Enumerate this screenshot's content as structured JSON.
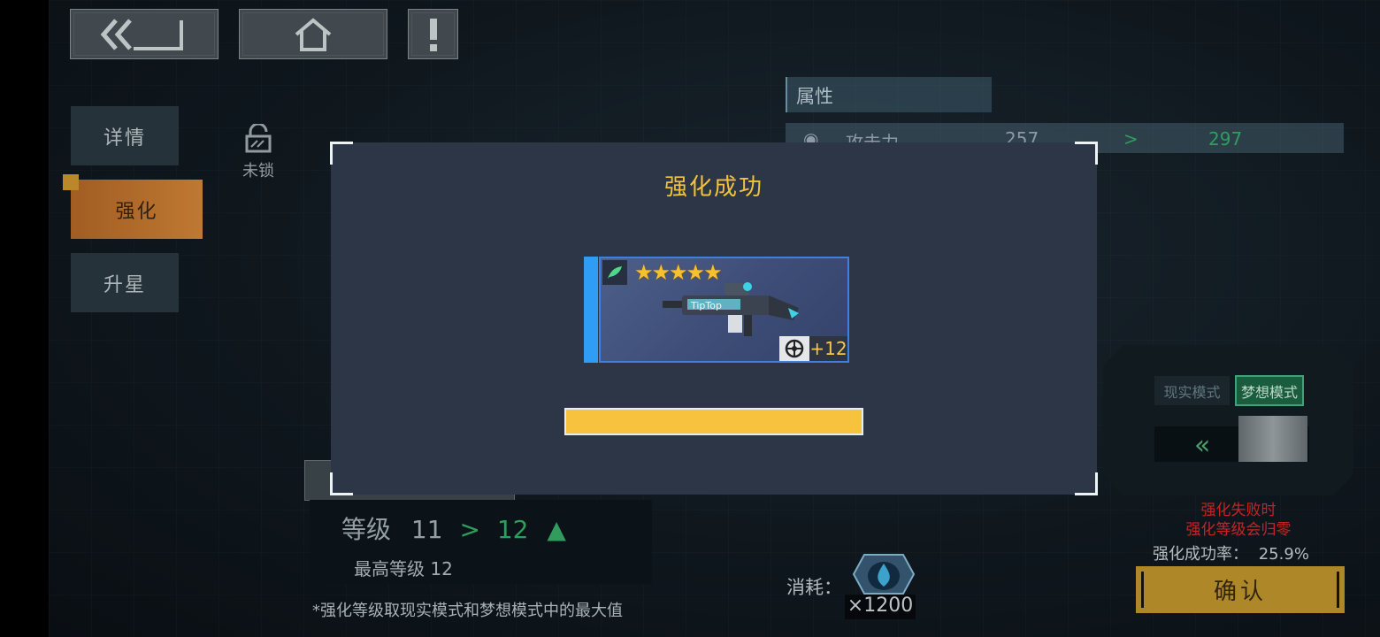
{
  "nav": {
    "back_icon": "double-chevron-left-icon",
    "home_icon": "home-icon",
    "alert_icon": "exclamation-icon"
  },
  "tabs": [
    {
      "label": "详情"
    },
    {
      "label": "强化",
      "active": true
    },
    {
      "label": "升星"
    }
  ],
  "lock": {
    "label": "未锁"
  },
  "attributes": {
    "header": "属性",
    "rows": [
      {
        "name": "攻击力",
        "from": "257",
        "arrow": ">",
        "to": "297"
      }
    ]
  },
  "level": {
    "label": "等级",
    "from": "11",
    "arrow": ">",
    "to": "12",
    "max_label": "最高等级 12"
  },
  "footnote": "*强化等级取现实模式和梦想模式中的最大值",
  "cost": {
    "label": "消耗：",
    "amount": "×1200"
  },
  "modes": {
    "real": "现实模式",
    "dream": "梦想模式",
    "selected": "dream"
  },
  "warning": {
    "line1": "强化失败时",
    "line2": "强化等级会归零"
  },
  "success_rate": {
    "label": "强化成功率：",
    "value": "25.9%"
  },
  "confirm": {
    "label": "确认"
  },
  "modal": {
    "title": "强化成功",
    "item": {
      "stars": "★★★★★",
      "star_count": 5,
      "enhance_level": "+12",
      "weapon_text": "TipTop"
    },
    "progress": 1.0
  },
  "colors": {
    "accent_gold": "#f2c23e",
    "tab_active": "#d98a3a",
    "success_green": "#37b36b",
    "warning_red": "#e02a2a"
  }
}
